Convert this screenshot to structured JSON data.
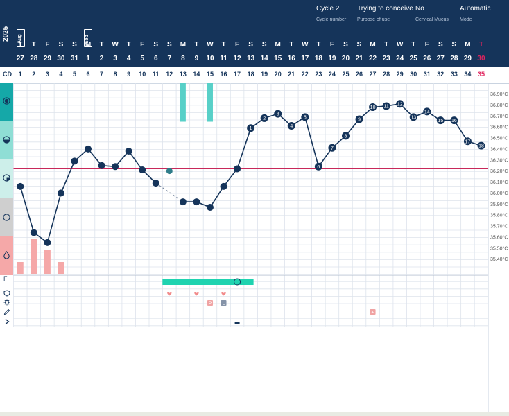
{
  "header": {
    "cycle": {
      "value": "Cycle 2",
      "label": "Cycle number"
    },
    "purpose": {
      "value": "Trying to conceive",
      "label": "Purpose of use"
    },
    "mucus": {
      "value": "No",
      "label": "Cervical Mucus"
    },
    "mode": {
      "value": "Automatic",
      "label": "Mode"
    },
    "year": "2025",
    "month_flags": [
      "Aug",
      "Sep"
    ]
  },
  "days": {
    "weekday": [
      "T",
      "T",
      "F",
      "S",
      "S",
      "M",
      "T",
      "W",
      "T",
      "F",
      "S",
      "S",
      "M",
      "T",
      "W",
      "T",
      "F",
      "S",
      "S",
      "M",
      "T",
      "W",
      "T",
      "F",
      "S",
      "S",
      "M",
      "T",
      "W",
      "T",
      "F",
      "S",
      "S",
      "M",
      "T"
    ],
    "date": [
      "27",
      "28",
      "29",
      "30",
      "31",
      "1",
      "2",
      "3",
      "4",
      "5",
      "6",
      "7",
      "8",
      "9",
      "10",
      "11",
      "12",
      "13",
      "14",
      "15",
      "16",
      "17",
      "18",
      "19",
      "20",
      "21",
      "22",
      "23",
      "24",
      "25",
      "26",
      "27",
      "28",
      "29",
      "30"
    ],
    "cd_label": "CD",
    "cycle_day": [
      "1",
      "2",
      "3",
      "4",
      "5",
      "6",
      "7",
      "8",
      "9",
      "10",
      "11",
      "12",
      "13",
      "14",
      "15",
      "16",
      "17",
      "18",
      "19",
      "20",
      "21",
      "22",
      "23",
      "24",
      "25",
      "26",
      "27",
      "28",
      "29",
      "30",
      "31",
      "32",
      "33",
      "34",
      "35"
    ],
    "today_index": 34
  },
  "colors": {
    "header_bg": "#15345a",
    "temp_line": "#15345a",
    "coverline": "#c8285a",
    "fertile": "#1fd3b0",
    "mucus_bar": "#58d0c8",
    "bleeding": "#f5a8a8",
    "sidebar_1": "#15a8a8",
    "sidebar_2": "#8fded5",
    "sidebar_3": "#cdefea",
    "sidebar_4": "#cfcfcf",
    "sidebar_5": "#f5a8a8"
  },
  "chart_data": {
    "type": "line",
    "xlabel": "CD",
    "ylabel": "",
    "ylim": [
      35.3,
      36.95
    ],
    "y_ticks": [
      "36.90°C",
      "36.80°C",
      "36.70°C",
      "36.60°C",
      "36.50°C",
      "36.40°C",
      "36.30°C",
      "36.20°C",
      "36.10°C",
      "36.00°C",
      "35.90°C",
      "35.80°C",
      "35.70°C",
      "35.60°C",
      "35.50°C",
      "35.40°C"
    ],
    "coverline": 36.22,
    "temperatures": [
      {
        "cd": 1,
        "t": 36.06
      },
      {
        "cd": 2,
        "t": 35.64
      },
      {
        "cd": 3,
        "t": 35.55
      },
      {
        "cd": 4,
        "t": 36.0
      },
      {
        "cd": 5,
        "t": 36.29
      },
      {
        "cd": 6,
        "t": 36.4
      },
      {
        "cd": 7,
        "t": 36.25
      },
      {
        "cd": 8,
        "t": 36.24
      },
      {
        "cd": 9,
        "t": 36.38
      },
      {
        "cd": 10,
        "t": 36.21
      },
      {
        "cd": 11,
        "t": 36.09
      },
      {
        "cd": 12,
        "t": 36.2,
        "excluded": true
      },
      {
        "cd": 13,
        "t": 35.92
      },
      {
        "cd": 14,
        "t": 35.92
      },
      {
        "cd": 15,
        "t": 35.87
      },
      {
        "cd": 16,
        "t": 36.06
      },
      {
        "cd": 17,
        "t": 36.22
      },
      {
        "cd": 18,
        "t": 36.59,
        "label": "1"
      },
      {
        "cd": 19,
        "t": 36.68,
        "label": "2"
      },
      {
        "cd": 20,
        "t": 36.72,
        "label": "3"
      },
      {
        "cd": 21,
        "t": 36.61,
        "label": "4"
      },
      {
        "cd": 22,
        "t": 36.69,
        "label": "5"
      },
      {
        "cd": 23,
        "t": 36.24,
        "label": "6"
      },
      {
        "cd": 24,
        "t": 36.41,
        "label": "7"
      },
      {
        "cd": 25,
        "t": 36.52,
        "label": "8"
      },
      {
        "cd": 26,
        "t": 36.67,
        "label": "9"
      },
      {
        "cd": 27,
        "t": 36.78,
        "label": "10"
      },
      {
        "cd": 28,
        "t": 36.79,
        "label": "11"
      },
      {
        "cd": 29,
        "t": 36.81,
        "label": "12"
      },
      {
        "cd": 30,
        "t": 36.69,
        "label": "13"
      },
      {
        "cd": 31,
        "t": 36.74,
        "label": "14"
      },
      {
        "cd": 32,
        "t": 36.66,
        "label": "15"
      },
      {
        "cd": 33,
        "t": 36.66,
        "label": "16"
      },
      {
        "cd": 34,
        "t": 36.47,
        "label": "17"
      },
      {
        "cd": 35,
        "t": 36.43,
        "label": "18"
      }
    ],
    "bleeding": [
      {
        "cd": 1,
        "level": 1
      },
      {
        "cd": 2,
        "level": 3
      },
      {
        "cd": 3,
        "level": 2
      },
      {
        "cd": 4,
        "level": 1
      }
    ],
    "cervical_mucus": [
      {
        "cd": 13,
        "level": 3
      },
      {
        "cd": 15,
        "level": 3
      }
    ],
    "fertile_window": {
      "start_cd": 12,
      "end_cd": 18,
      "peak_cd": 17
    },
    "intercourse": [
      12,
      14,
      16
    ],
    "tests": [
      {
        "cd": 15,
        "text": "P"
      },
      {
        "cd": 16,
        "text": "L"
      }
    ],
    "notes": [
      {
        "cd": 27,
        "text": "+"
      }
    ],
    "extra_mark_cd": 17
  }
}
